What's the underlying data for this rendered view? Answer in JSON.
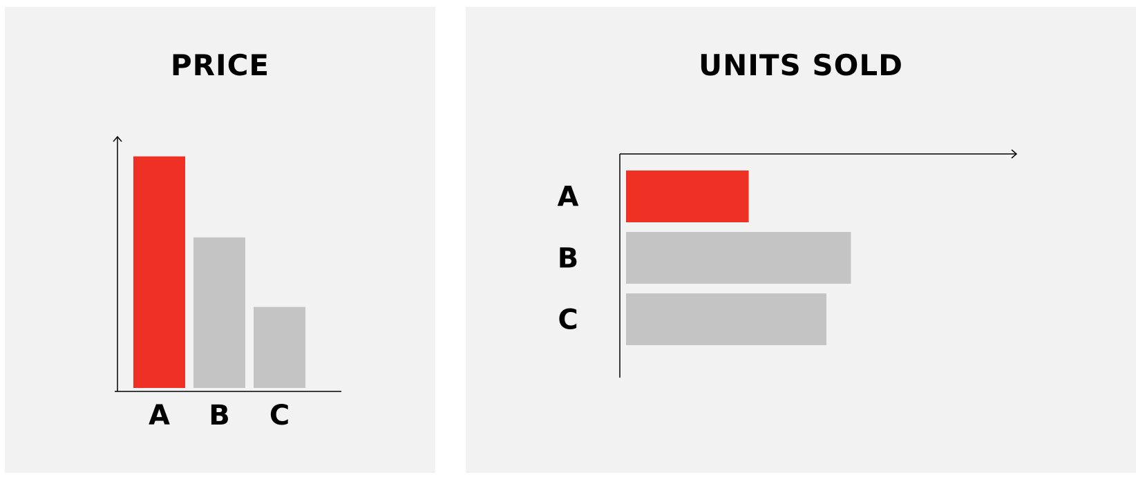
{
  "chart_data": [
    {
      "type": "bar",
      "orientation": "vertical",
      "title": "PRICE",
      "categories": [
        "A",
        "B",
        "C"
      ],
      "values": [
        100,
        65,
        35
      ],
      "ylim": [
        0,
        110
      ],
      "colors": [
        "#ee3124",
        "#c4c4c4",
        "#c4c4c4"
      ],
      "grid": false,
      "legend": "none",
      "axis_arrow": "y"
    },
    {
      "type": "bar",
      "orientation": "horizontal",
      "title": "UNITS SOLD",
      "categories": [
        "A",
        "B",
        "C"
      ],
      "values": [
        30,
        55,
        49
      ],
      "xlim": [
        0,
        97
      ],
      "colors": [
        "#ee3124",
        "#c4c4c4",
        "#c4c4c4"
      ],
      "grid": false,
      "legend": "none",
      "axis_arrow": "x"
    }
  ]
}
